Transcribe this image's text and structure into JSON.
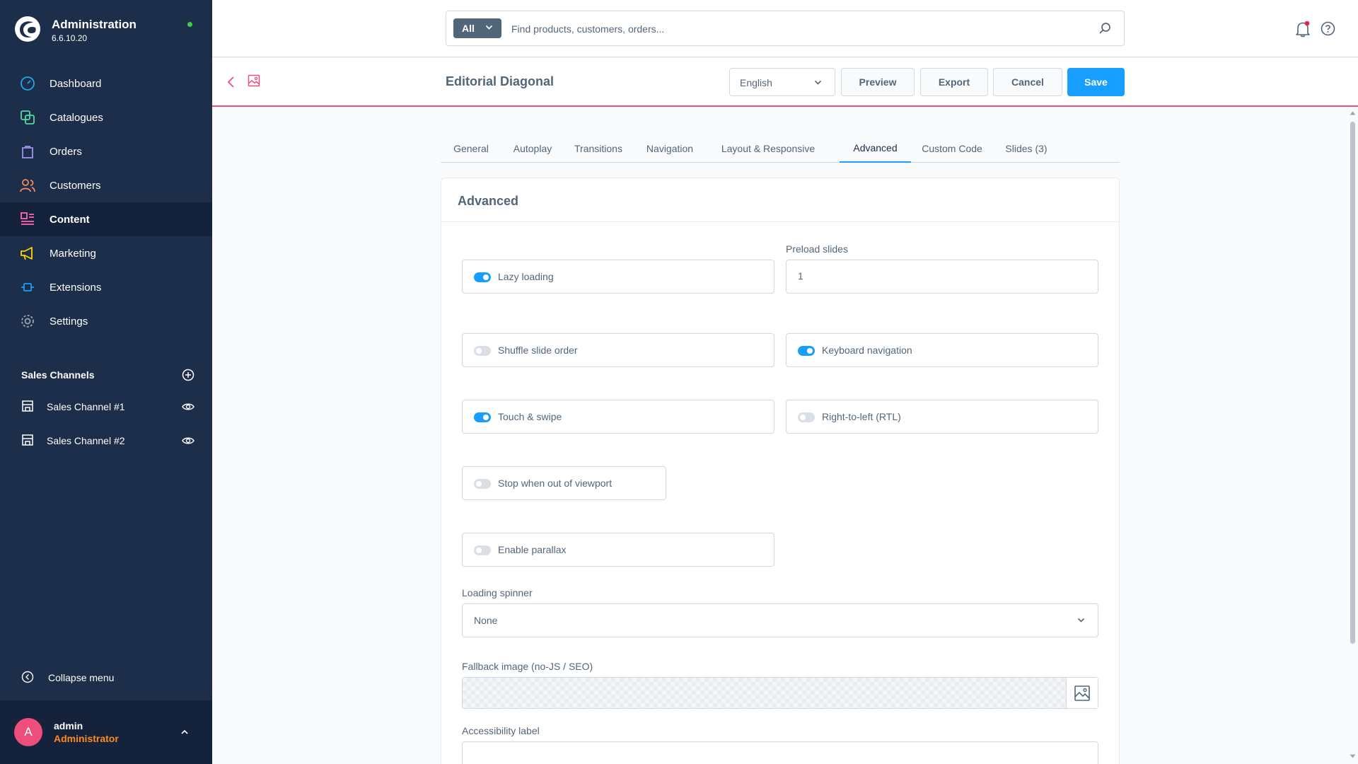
{
  "brand": {
    "title": "Administration",
    "version": "6.6.10.20",
    "status_color": "#37d046"
  },
  "nav": {
    "items": [
      {
        "label": "Dashboard",
        "icon": "dashboard-icon",
        "color": "#20a8e8"
      },
      {
        "label": "Catalogues",
        "icon": "catalogues-icon",
        "color": "#57d9a3"
      },
      {
        "label": "Orders",
        "icon": "orders-icon",
        "color": "#a092f0"
      },
      {
        "label": "Customers",
        "icon": "customers-icon",
        "color": "#f88962"
      },
      {
        "label": "Content",
        "icon": "content-icon",
        "color": "#ff68b4"
      },
      {
        "label": "Marketing",
        "icon": "marketing-icon",
        "color": "#ffd700"
      },
      {
        "label": "Extensions",
        "icon": "extensions-icon",
        "color": "#189eff"
      },
      {
        "label": "Settings",
        "icon": "settings-icon",
        "color": "#9aa8b5"
      }
    ],
    "active": "Content"
  },
  "sales_channels": {
    "title": "Sales Channels",
    "items": [
      {
        "label": "Sales Channel #1"
      },
      {
        "label": "Sales Channel #2"
      }
    ]
  },
  "collapse_label": "Collapse menu",
  "user": {
    "initial": "A",
    "name": "admin",
    "role": "Administrator"
  },
  "search": {
    "type_label": "All",
    "placeholder": "Find products, customers, orders..."
  },
  "header": {
    "title": "Editorial Diagonal",
    "language": "English",
    "preview_label": "Preview",
    "export_label": "Export",
    "cancel_label": "Cancel",
    "save_label": "Save"
  },
  "tabs": [
    {
      "label": "General"
    },
    {
      "label": "Autoplay"
    },
    {
      "label": "Transitions"
    },
    {
      "label": "Navigation"
    },
    {
      "label": "Layout & Responsive"
    },
    {
      "label": "Advanced"
    },
    {
      "label": "Custom Code"
    },
    {
      "label": "Slides (3)"
    }
  ],
  "active_tab": "Advanced",
  "advanced": {
    "title": "Advanced",
    "lazy_loading": {
      "label": "Lazy loading",
      "on": true
    },
    "preload_slides": {
      "label": "Preload slides",
      "value": "1"
    },
    "shuffle": {
      "label": "Shuffle slide order",
      "on": false
    },
    "keyboard": {
      "label": "Keyboard navigation",
      "on": true
    },
    "touch": {
      "label": "Touch & swipe",
      "on": true
    },
    "rtl": {
      "label": "Right-to-left (RTL)",
      "on": false
    },
    "stop_viewport": {
      "label": "Stop when out of viewport",
      "on": false
    },
    "parallax": {
      "label": "Enable parallax",
      "on": false
    },
    "spinner": {
      "label": "Loading spinner",
      "value": "None"
    },
    "fallback": {
      "label": "Fallback image (no-JS / SEO)"
    },
    "a11y": {
      "label": "Accessibility label",
      "value": ""
    }
  },
  "colors": {
    "primary": "#189eff",
    "accent": "#ed4f7c",
    "sidebar": "#1c2e4a",
    "role": "#ff8a1a"
  }
}
